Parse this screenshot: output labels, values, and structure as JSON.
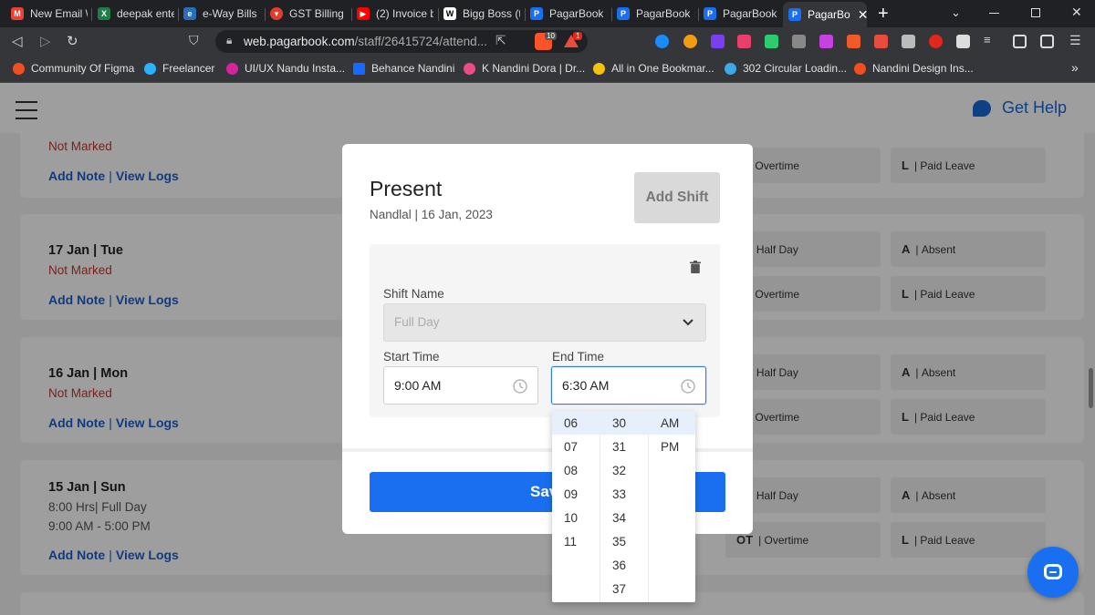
{
  "browser": {
    "tabs": [
      {
        "label": "New Email \\",
        "icon": "gmail-icon",
        "color": "#ea4335"
      },
      {
        "label": "deepak ente",
        "icon": "excel-icon",
        "color": "#1e7e45"
      },
      {
        "label": "e-Way Bills |",
        "icon": "eway-icon",
        "color": "#2a6ebb"
      },
      {
        "label": "GST Billing S",
        "icon": "gst-icon",
        "color": "#e23c2c"
      },
      {
        "label": "(2) Invoice b",
        "icon": "youtube-icon",
        "color": "#ff0000"
      },
      {
        "label": "Bigg Boss (t",
        "icon": "wikipedia-icon",
        "color": "#ffffff"
      },
      {
        "label": "PagarBook",
        "icon": "pagarbook-icon",
        "color": "#1a6ff0"
      },
      {
        "label": "PagarBook",
        "icon": "pagarbook-icon",
        "color": "#1a6ff0"
      },
      {
        "label": "PagarBook",
        "icon": "pagarbook-icon",
        "color": "#1a6ff0"
      },
      {
        "label": "PagarBo",
        "icon": "pagarbook-icon",
        "color": "#1a6ff0"
      }
    ],
    "url_host": "web.pagarbook.com",
    "url_path": "/staff/26415724/attend...",
    "brave_badge": "10",
    "alert_badge": "1",
    "bookmarks": [
      {
        "label": "Community Of Figma",
        "color": "#f24e1e"
      },
      {
        "label": "Freelancer",
        "color": "#29b2fe"
      },
      {
        "label": "UI/UX Nandu Insta...",
        "color": "#d6249f"
      },
      {
        "label": "Behance Nandini",
        "color": "#1769ff"
      },
      {
        "label": "K Nandini Dora | Dr...",
        "color": "#ea4c89"
      },
      {
        "label": "All in One Bookmar...",
        "color": "#f4c20d"
      },
      {
        "label": "302 Circular Loadin...",
        "color": "#3ca9e8"
      },
      {
        "label": "Nandini Design Ins...",
        "color": "#f24e1e"
      }
    ],
    "bookmarks_more": "»"
  },
  "header": {
    "help_label": "Get Help"
  },
  "days": [
    {
      "title": "",
      "status": "Not Marked",
      "add_note": "Add Note",
      "sep": "|",
      "view_logs": "View Logs",
      "options": [
        {
          "code": "T",
          "label": "Overtime"
        },
        {
          "code": "L",
          "label": "Paid Leave"
        }
      ]
    },
    {
      "title": "17 Jan | Tue",
      "status": "Not Marked",
      "add_note": "Add Note",
      "sep": "|",
      "view_logs": "View Logs",
      "options": [
        {
          "code": "D",
          "label": "Half Day"
        },
        {
          "code": "A",
          "label": "Absent"
        },
        {
          "code": "T",
          "label": "Overtime"
        },
        {
          "code": "L",
          "label": "Paid Leave"
        }
      ]
    },
    {
      "title": "16 Jan | Mon",
      "status": "Not Marked",
      "add_note": "Add Note",
      "sep": "|",
      "view_logs": "View Logs",
      "options": [
        {
          "code": "D",
          "label": "Half Day"
        },
        {
          "code": "A",
          "label": "Absent"
        },
        {
          "code": "T",
          "label": "Overtime"
        },
        {
          "code": "L",
          "label": "Paid Leave"
        }
      ]
    },
    {
      "title": "15 Jan | Sun",
      "status": "8:00 Hrs| Full Day",
      "status2": "9:00 AM - 5:00 PM",
      "add_note": "Add Note",
      "sep": "|",
      "view_logs": "View Logs",
      "options": [
        {
          "code": "D",
          "label": "Half Day"
        },
        {
          "code": "A",
          "label": "Absent"
        },
        {
          "code": "OT",
          "label": "Overtime"
        },
        {
          "code": "L",
          "label": "Paid Leave"
        }
      ]
    }
  ],
  "modal": {
    "title": "Present",
    "subtitle": "Nandlal | 16 Jan, 2023",
    "add_shift_label": "Add Shift",
    "shift_name_label": "Shift Name",
    "shift_name_value": "Full Day",
    "start_time_label": "Start Time",
    "start_time_value": "9:00 AM",
    "end_time_label": "End Time",
    "end_time_value": "6:30 AM",
    "save_label": "Save"
  },
  "picker": {
    "hours": [
      "06",
      "07",
      "08",
      "09",
      "10",
      "11"
    ],
    "minutes": [
      "30",
      "31",
      "32",
      "33",
      "34",
      "35",
      "36",
      "37"
    ],
    "periods": [
      "AM",
      "PM"
    ],
    "selected_hour": "06",
    "selected_minute": "30",
    "selected_period": "AM"
  },
  "colors": {
    "accent": "#1a6ff0",
    "link": "#1c5fcf",
    "not_marked": "#c0392b"
  }
}
